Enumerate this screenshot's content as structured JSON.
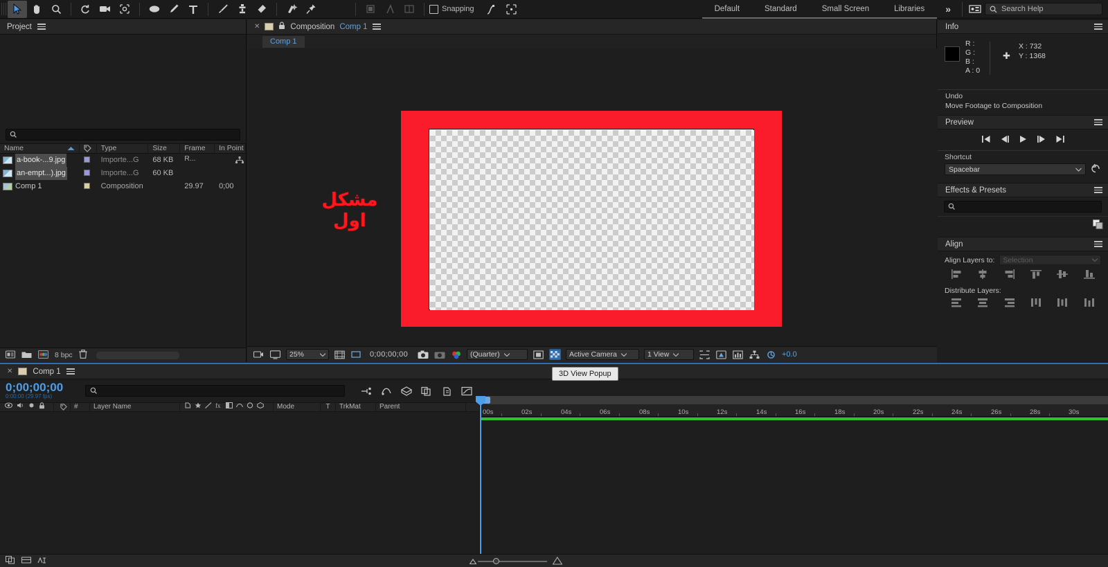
{
  "app": {
    "title": "Adobe After Effects"
  },
  "toolbar": {
    "tools": [
      {
        "name": "selection-tool",
        "glyph": "arrow",
        "active": true
      },
      {
        "name": "hand-tool",
        "glyph": "hand",
        "active": false
      },
      {
        "name": "zoom-tool",
        "glyph": "magnifier",
        "active": false
      },
      {
        "name": "rotation-tool",
        "glyph": "rotate",
        "active": false
      },
      {
        "name": "camera-tool",
        "glyph": "camera",
        "active": false
      },
      {
        "name": "pan-behind-tool",
        "glyph": "anchor",
        "active": false
      },
      {
        "name": "shape-tool",
        "glyph": "ellipse",
        "active": false
      },
      {
        "name": "pen-tool",
        "glyph": "pen",
        "active": false
      },
      {
        "name": "type-tool",
        "glyph": "T",
        "active": false
      },
      {
        "name": "brush-tool",
        "glyph": "brush",
        "active": false
      },
      {
        "name": "clone-stamp-tool",
        "glyph": "stamp",
        "active": false
      },
      {
        "name": "eraser-tool",
        "glyph": "eraser",
        "active": false
      },
      {
        "name": "roto-brush-tool",
        "glyph": "roto",
        "active": false
      },
      {
        "name": "puppet-pin-tool",
        "glyph": "pin",
        "active": false
      }
    ],
    "snapping_label": "Snapping",
    "workspaces": [
      "Default",
      "Standard",
      "Small Screen",
      "Libraries"
    ],
    "more_label": "»",
    "search_placeholder": "Search Help"
  },
  "project": {
    "tab_label": "Project",
    "search_value": "",
    "columns": [
      "Name",
      "",
      "Type",
      "Size",
      "Frame R...",
      "In Point"
    ],
    "items": [
      {
        "name": "a-book-...9.jpg",
        "type": "Importe...G",
        "size": "68 KB",
        "frame_rate": "",
        "in_point": "",
        "highlighted": true,
        "kind": "image"
      },
      {
        "name": "an-empt...).jpg",
        "type": "Importe...G",
        "size": "60 KB",
        "frame_rate": "",
        "in_point": "",
        "highlighted": true,
        "kind": "image"
      },
      {
        "name": "Comp 1",
        "type": "Composition",
        "size": "",
        "frame_rate": "29.97",
        "in_point": "0;00",
        "highlighted": false,
        "kind": "comp"
      }
    ],
    "bit_depth": "8 bpc"
  },
  "composition": {
    "panel_prefix": "Composition",
    "comp_name": "Comp 1",
    "sub_tab": "Comp 1",
    "artwork_text": "مشکل اول",
    "toolbar": {
      "zoom": "25%",
      "timecode": "0;00;00;00",
      "resolution": "(Quarter)",
      "camera": "Active Camera",
      "views": "1 View",
      "exposure": "+0.0"
    }
  },
  "info": {
    "title": "Info",
    "r_label": "R :",
    "g_label": "G :",
    "b_label": "B :",
    "a_label": "A :",
    "r_value": "",
    "g_value": "",
    "b_value": "",
    "a_value": "0",
    "x_label": "X :",
    "y_label": "Y :",
    "x_value": "732",
    "y_value": "1368",
    "undo_label": "Undo",
    "undo_action": "Move Footage to Composition"
  },
  "preview": {
    "title": "Preview",
    "transport": [
      "first-frame",
      "prev-frame",
      "play",
      "next-frame",
      "last-frame"
    ],
    "shortcut_label": "Shortcut",
    "shortcut_value": "Spacebar"
  },
  "effects_presets": {
    "title": "Effects & Presets",
    "search_value": ""
  },
  "align": {
    "title": "Align",
    "align_layers_label": "Align Layers to:",
    "align_target": "Selection",
    "distribute_label": "Distribute Layers:"
  },
  "timeline": {
    "tab_label": "Comp 1",
    "timecode": "0;00;00;00",
    "timecode_sub": "0:00:00 (29.97 fps)",
    "search_value": "",
    "columns": [
      "",
      "#",
      "Layer Name",
      "Mode",
      "T",
      "TrkMat",
      "Parent"
    ],
    "ruler_ticks": [
      "00s",
      "02s",
      "04s",
      "06s",
      "08s",
      "10s",
      "12s",
      "14s",
      "16s",
      "18s",
      "20s",
      "22s",
      "24s",
      "26s",
      "28s",
      "30s"
    ],
    "tooltip": "3D View Popup"
  },
  "colors": {
    "accent_blue": "#4d9de8",
    "frame_red": "#fa1c2a",
    "work_area_green": "#2ec12e",
    "panel_bg": "#1e1e1e",
    "header_bg": "#262626"
  }
}
